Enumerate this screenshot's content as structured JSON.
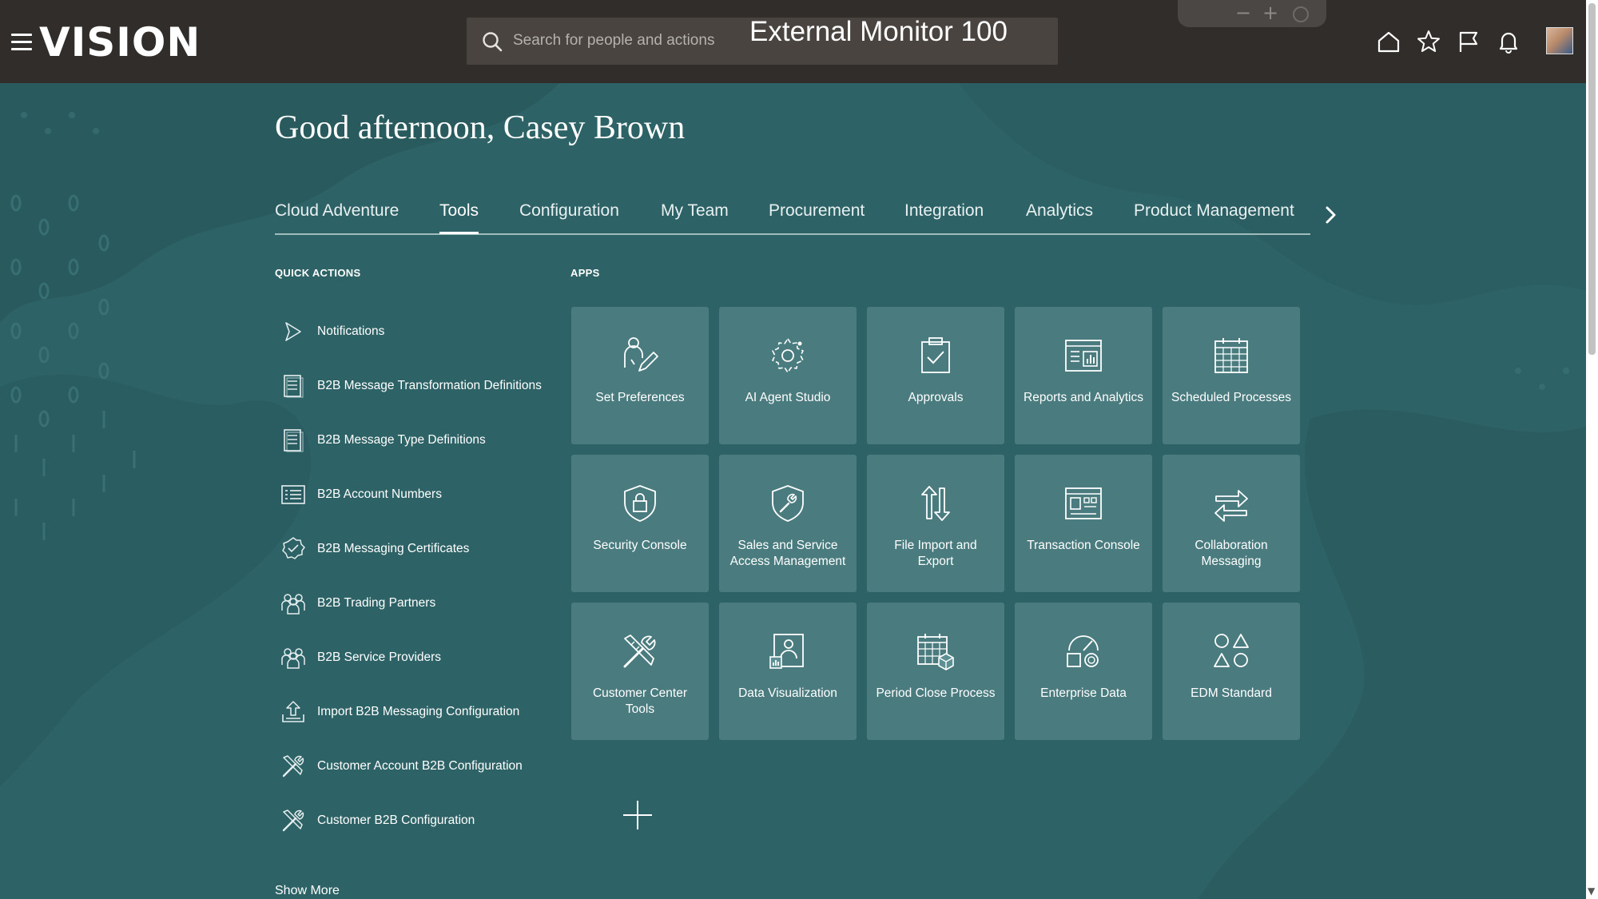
{
  "header": {
    "brand": "VISION",
    "search_placeholder": "Search for people and actions",
    "monitor_label": "External Monitor 100",
    "zoom_minus": "−",
    "zoom_plus": "+"
  },
  "greeting": "Good afternoon, Casey Brown",
  "tabs": [
    {
      "label": "Cloud Adventure",
      "active": false
    },
    {
      "label": "Tools",
      "active": true
    },
    {
      "label": "Configuration",
      "active": false
    },
    {
      "label": "My Team",
      "active": false
    },
    {
      "label": "Procurement",
      "active": false
    },
    {
      "label": "Integration",
      "active": false
    },
    {
      "label": "Analytics",
      "active": false
    },
    {
      "label": "Product Management",
      "active": false
    }
  ],
  "quick_actions": {
    "title": "QUICK ACTIONS",
    "items": [
      {
        "label": "Notifications",
        "icon": "flag-icon"
      },
      {
        "label": "B2B Message Transformation Definitions",
        "icon": "document-list-icon"
      },
      {
        "label": "B2B Message Type Definitions",
        "icon": "document-list-icon"
      },
      {
        "label": "B2B Account Numbers",
        "icon": "table-list-icon"
      },
      {
        "label": "B2B Messaging Certificates",
        "icon": "certificate-badge-icon"
      },
      {
        "label": "B2B Trading Partners",
        "icon": "people-group-icon"
      },
      {
        "label": "B2B Service Providers",
        "icon": "people-group-icon"
      },
      {
        "label": "Import B2B Messaging Configuration",
        "icon": "upload-tray-icon"
      },
      {
        "label": "Customer Account B2B Configuration",
        "icon": "tools-icon"
      },
      {
        "label": "Customer B2B Configuration",
        "icon": "tools-icon"
      }
    ],
    "show_more": "Show More"
  },
  "apps": {
    "title": "APPS",
    "tiles": [
      {
        "label": "Set Preferences",
        "icon": "user-edit-icon"
      },
      {
        "label": "AI Agent Studio",
        "icon": "ai-agent-icon"
      },
      {
        "label": "Approvals",
        "icon": "clipboard-check-icon"
      },
      {
        "label": "Reports and Analytics",
        "icon": "report-chart-icon"
      },
      {
        "label": "Scheduled Processes",
        "icon": "calendar-grid-icon"
      },
      {
        "label": "Security Console",
        "icon": "shield-lock-icon"
      },
      {
        "label": "Sales and Service Access Management",
        "icon": "shield-wrench-icon"
      },
      {
        "label": "File Import and Export",
        "icon": "import-export-icon"
      },
      {
        "label": "Transaction Console",
        "icon": "console-window-icon"
      },
      {
        "label": "Collaboration Messaging",
        "icon": "swap-arrows-icon"
      },
      {
        "label": "Customer Center Tools",
        "icon": "tools-icon"
      },
      {
        "label": "Data Visualization",
        "icon": "data-person-icon"
      },
      {
        "label": "Period Close Process",
        "icon": "calendar-cube-icon"
      },
      {
        "label": "Enterprise Data",
        "icon": "gauge-shapes-icon"
      },
      {
        "label": "EDM Standard",
        "icon": "shapes-icon"
      }
    ]
  },
  "colors": {
    "header_bg": "#312d2a",
    "page_bg": "#2f6468",
    "tile_bg": "rgba(135,178,180,0.32)"
  }
}
